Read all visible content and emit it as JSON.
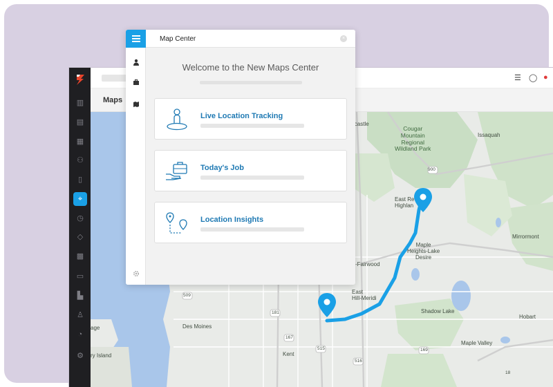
{
  "app": {
    "tab_title": "Maps",
    "topbar_icons": [
      "menu-icon",
      "chat-icon",
      "notification-icon"
    ],
    "rail_items": [
      {
        "name": "dashboard-icon",
        "glyph": "▥"
      },
      {
        "name": "jobs-icon",
        "glyph": "▤"
      },
      {
        "name": "calendar-icon",
        "glyph": "▦"
      },
      {
        "name": "team-icon",
        "glyph": "⚇"
      },
      {
        "name": "device-icon",
        "glyph": "▯"
      },
      {
        "name": "map-icon",
        "glyph": "⌖",
        "active": true
      },
      {
        "name": "clock-icon",
        "glyph": "◷"
      },
      {
        "name": "tag-icon",
        "glyph": "◇"
      },
      {
        "name": "grid-icon",
        "glyph": "▩"
      },
      {
        "name": "document-icon",
        "glyph": "▭"
      },
      {
        "name": "building-icon",
        "glyph": "▙"
      },
      {
        "name": "user-icon",
        "glyph": "♙"
      },
      {
        "name": "chart-icon",
        "glyph": "◔"
      },
      {
        "name": "settings-icon",
        "glyph": "⚙"
      }
    ],
    "accent_color": "#1aa0e6"
  },
  "map": {
    "labels": {
      "newcastle": "wcastle",
      "cougar": "Cougar\nMountain\nRegional\nWildland Park",
      "issaquah": "Issaquah",
      "road_900": "900",
      "east_renton": "East Re\nHighlan",
      "mirrormont": "Mirrormont",
      "maple_heights": "Maple\nHeights-Lake\nDesire",
      "fairwood": "-Fairwood",
      "east_hill": "East\nHill-Meridi",
      "shadow_lake": "Shadow Lake",
      "hobart": "Hobart",
      "des_moines": "Des Moines",
      "kent": "Kent",
      "maple_valley": "Maple Valley",
      "island": "ry Island",
      "age": "age",
      "r509": "509",
      "r181": "181",
      "r167": "167",
      "r516": "516",
      "r515": "515",
      "r169": "169",
      "r18": "18"
    },
    "route_color": "#1aa0e6"
  },
  "panel": {
    "title": "Map Center",
    "close_glyph": "×",
    "welcome": "Welcome to the New Maps Center",
    "side_icons": [
      "user-icon",
      "briefcase-icon",
      "map-icon",
      "settings-icon"
    ],
    "cards": [
      {
        "label": "Live Location Tracking",
        "icon": "location-person-icon"
      },
      {
        "label": "Today's Job",
        "icon": "briefcase-hand-icon"
      },
      {
        "label": "Location Insights",
        "icon": "location-pins-icon"
      }
    ]
  }
}
